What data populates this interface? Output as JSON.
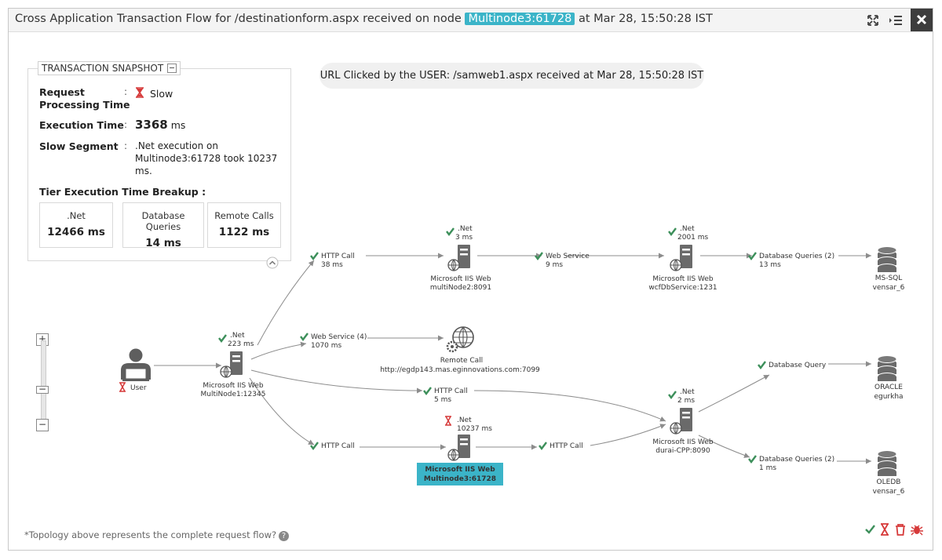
{
  "header": {
    "title_prefix": "Cross Application Transaction Flow for /destinationform.aspx received on node",
    "node": "Multinode3:61728",
    "title_suffix": "at Mar 28, 15:50:28 IST"
  },
  "snapshot": {
    "title": "TRANSACTION SNAPSHOT",
    "rows": [
      {
        "label1": "Request",
        "label2": "Processing Time",
        "value": "Slow"
      },
      {
        "label": "Execution Time",
        "value_num": "3368",
        "value_unit": "ms"
      },
      {
        "label": "Slow Segment",
        "value_l1": ".Net execution on",
        "value_l2": "Multinode3:61728 took 10237",
        "value_l3": "ms."
      }
    ],
    "breakup_title": "Tier Execution Time Breakup :",
    "tiers": [
      {
        "name": ".Net",
        "value": "12466 ms"
      },
      {
        "name": "Database Queries",
        "value": "14 ms"
      },
      {
        "name": "Remote Calls",
        "value": "1122 ms"
      }
    ]
  },
  "url_banner": "URL Clicked by the USER: /samweb1.aspx received at Mar 28, 15:50:28 IST",
  "footnote": "*Topology above represents the complete request flow?",
  "topology": {
    "user": {
      "label": "User"
    },
    "nodes": {
      "multinode1": {
        "metric_name": ".Net",
        "metric_value": "223 ms",
        "name": "Microsoft IIS Web",
        "id": "MultiNode1:12345"
      },
      "multinode2": {
        "metric_name": ".Net",
        "metric_value": "3 ms",
        "name": "Microsoft IIS Web",
        "id": "multiNode2:8091"
      },
      "wcf": {
        "metric_name": ".Net",
        "metric_value": "2001 ms",
        "name": "Microsoft IIS Web",
        "id": "wcfDbService:1231"
      },
      "remote": {
        "name": "Remote Call",
        "id": "http://egdp143.mas.eginnovations.com:7099"
      },
      "multinode3": {
        "metric_name": ".Net",
        "metric_value": "10237 ms",
        "name": "Microsoft IIS Web",
        "id": "Multinode3:61728"
      },
      "durai": {
        "metric_name": ".Net",
        "metric_value": "2 ms",
        "name": "Microsoft IIS Web",
        "id": "durai-CPP:8090"
      }
    },
    "databases": {
      "mssql": {
        "name": "MS-SQL",
        "id": "vensar_6"
      },
      "oracle": {
        "name": "ORACLE",
        "id": "egurkha"
      },
      "oledb": {
        "name": "OLEDB",
        "id": "vensar_6"
      }
    },
    "edges": {
      "e1": {
        "name": "HTTP Call",
        "time": "38 ms"
      },
      "e2": {
        "name": "Web Service",
        "time": "9 ms"
      },
      "e3": {
        "name": "Database Queries (2)",
        "time": "13 ms"
      },
      "e4": {
        "name": "Web Service (4)",
        "time": "1070 ms"
      },
      "e5": {
        "name": "HTTP Call",
        "time": "5 ms"
      },
      "e6": {
        "name": "HTTP Call"
      },
      "e7": {
        "name": "HTTP Call"
      },
      "e8": {
        "name": "Database Query"
      },
      "e9": {
        "name": "Database Queries (2)",
        "time": "1 ms"
      }
    }
  },
  "colors": {
    "accent": "#3bb4c8",
    "ok": "#3c8f5a",
    "slow": "#d63a3a",
    "line": "#8c8c8c"
  }
}
